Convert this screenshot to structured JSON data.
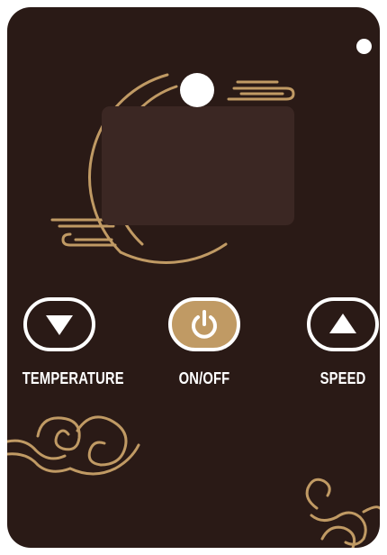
{
  "controls": {
    "temperature_label": "TEMPERATURE",
    "power_label": "ON/OFF",
    "speed_label": "SPEED"
  },
  "icons": {
    "temperature_button": "triangle-down-icon",
    "power_button": "power-icon",
    "speed_button": "triangle-up-icon",
    "indicator": "dot-icon",
    "moon": "moon-icon"
  },
  "colors": {
    "panel": "#2a1a16",
    "display": "#3b2723",
    "accent_gold": "#c09a64",
    "foreground": "#ffffff"
  }
}
